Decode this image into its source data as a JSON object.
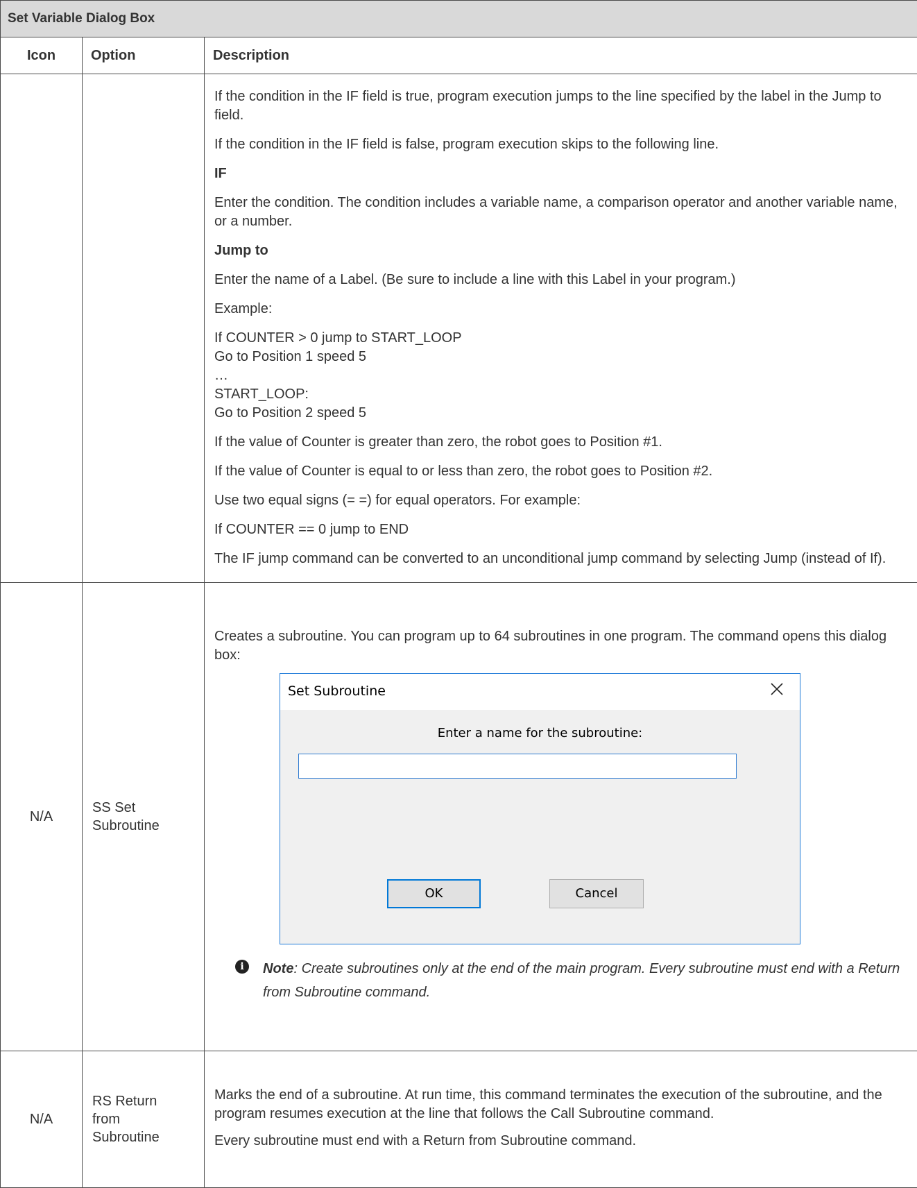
{
  "table": {
    "caption": "Set Variable Dialog Box",
    "headers": {
      "icon": "Icon",
      "option": "Option",
      "description": "Description"
    }
  },
  "row1": {
    "icon": "",
    "option": "",
    "p1": "If the condition in the IF field is true, program execution jumps to the line specified by the label in the Jump to field.",
    "p2": "If the condition in the IF field is false, program execution skips to the following line.",
    "if_heading": "IF",
    "p3": "Enter the condition. The condition includes a variable name, a comparison operator and another variable name, or a number.",
    "jump_heading": "Jump to",
    "p4": "Enter the name of a Label. (Be sure to include a line with this Label in your program.)",
    "example_label": "Example:",
    "code_lines": [
      "If COUNTER > 0 jump to START_LOOP",
      "Go to Position 1 speed 5",
      "…",
      "START_LOOP:",
      "Go to Position 2 speed 5"
    ],
    "p5": "If the value of Counter is greater than zero, the robot goes to Position #1.",
    "p6": "If the value of Counter is equal to or less than zero, the robot goes to Position #2.",
    "p7": "Use two equal signs (= =) for equal operators. For example:",
    "p8": "If COUNTER == 0 jump to END",
    "p9": "The IF jump command can be converted to an unconditional jump command by selecting Jump (instead of If)."
  },
  "row2": {
    "icon": "N/A",
    "option_line1": "SS Set",
    "option_line2": "Subroutine",
    "p1": "Creates a subroutine. You can program up to 64 subroutines in one program. The command opens this dialog box:",
    "dialog": {
      "title": "Set Subroutine",
      "prompt": "Enter a name for the subroutine:",
      "input_value": "",
      "ok_label": "OK",
      "cancel_label": "Cancel"
    },
    "note_label": "Note",
    "note_text": ": Create subroutines only at the end of the main program. Every subroutine must end with a Return from Subroutine command."
  },
  "row3": {
    "icon": "N/A",
    "option_line1": "RS Return",
    "option_line2": "from",
    "option_line3": "Subroutine",
    "p1": "Marks the end of a subroutine. At run time, this command terminates the execution of the subroutine, and the program resumes execution at the line that follows the Call Subroutine command.",
    "p2": "Every subroutine must end with a Return from Subroutine command."
  }
}
